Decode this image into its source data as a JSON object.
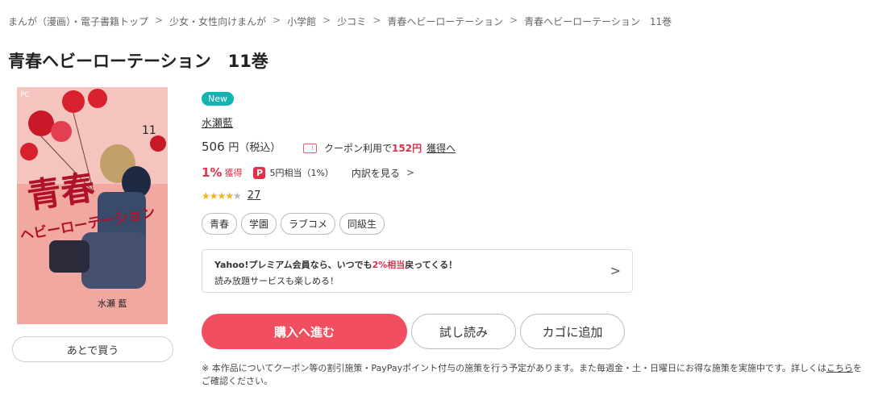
{
  "breadcrumb": {
    "items": [
      "まんが（漫画）・電子書籍トップ",
      "少女・女性向けまんが",
      "小学館",
      "少コミ",
      "青春ヘビーローテーション",
      "青春ヘビーローテーション　11巻"
    ],
    "separator": ">"
  },
  "title": "青春ヘビーローテーション　11巻",
  "cover": {
    "label": "PC",
    "volume": "11",
    "title_big": "青春",
    "title_sub": "ヘビーローテーション",
    "author_on_cover": "水瀬 藍",
    "colors": {
      "background": "#f0a8a0",
      "balloon": "#d8202e",
      "hair": "#c2a06a"
    }
  },
  "later_button": "あとで買う",
  "badge_new": "New",
  "author": "水瀬藍",
  "price": {
    "amount": "506",
    "yen": "円（税込）"
  },
  "coupon": {
    "prefix": "クーポン利用で",
    "amount": "152円",
    "link": "獲得へ"
  },
  "points": {
    "percent": "1%",
    "earn": "獲得",
    "pp_icon": "P",
    "equivalent": "5円相当（1%）",
    "breakdown": "内訳を見る"
  },
  "rating": {
    "stars": 4.5,
    "count": "27"
  },
  "tags": [
    "青春",
    "学園",
    "ラブコメ",
    "同級生"
  ],
  "promo": {
    "line1_a": "Yahoo!プレミアム会員なら、いつでも",
    "line1_hl": "2%相当",
    "line1_b": "戻ってくる！",
    "line2": "読み放題サービスも楽しめる！"
  },
  "buttons": {
    "buy": "購入へ進む",
    "sample": "試し読み",
    "cart": "カゴに追加"
  },
  "note": {
    "text_a": "※ 本作品についてクーポン等の割引施策・PayPayポイント付与の施策を行う予定があります。また毎週金・土・日曜日にお得な施策を実施中です。詳しくは",
    "link": "こちら",
    "text_b": "をご確認ください。"
  },
  "colors": {
    "accent": "#f14f5f",
    "new_badge": "#12b3b3",
    "highlight": "#e0314b",
    "star": "#f2b31b"
  }
}
